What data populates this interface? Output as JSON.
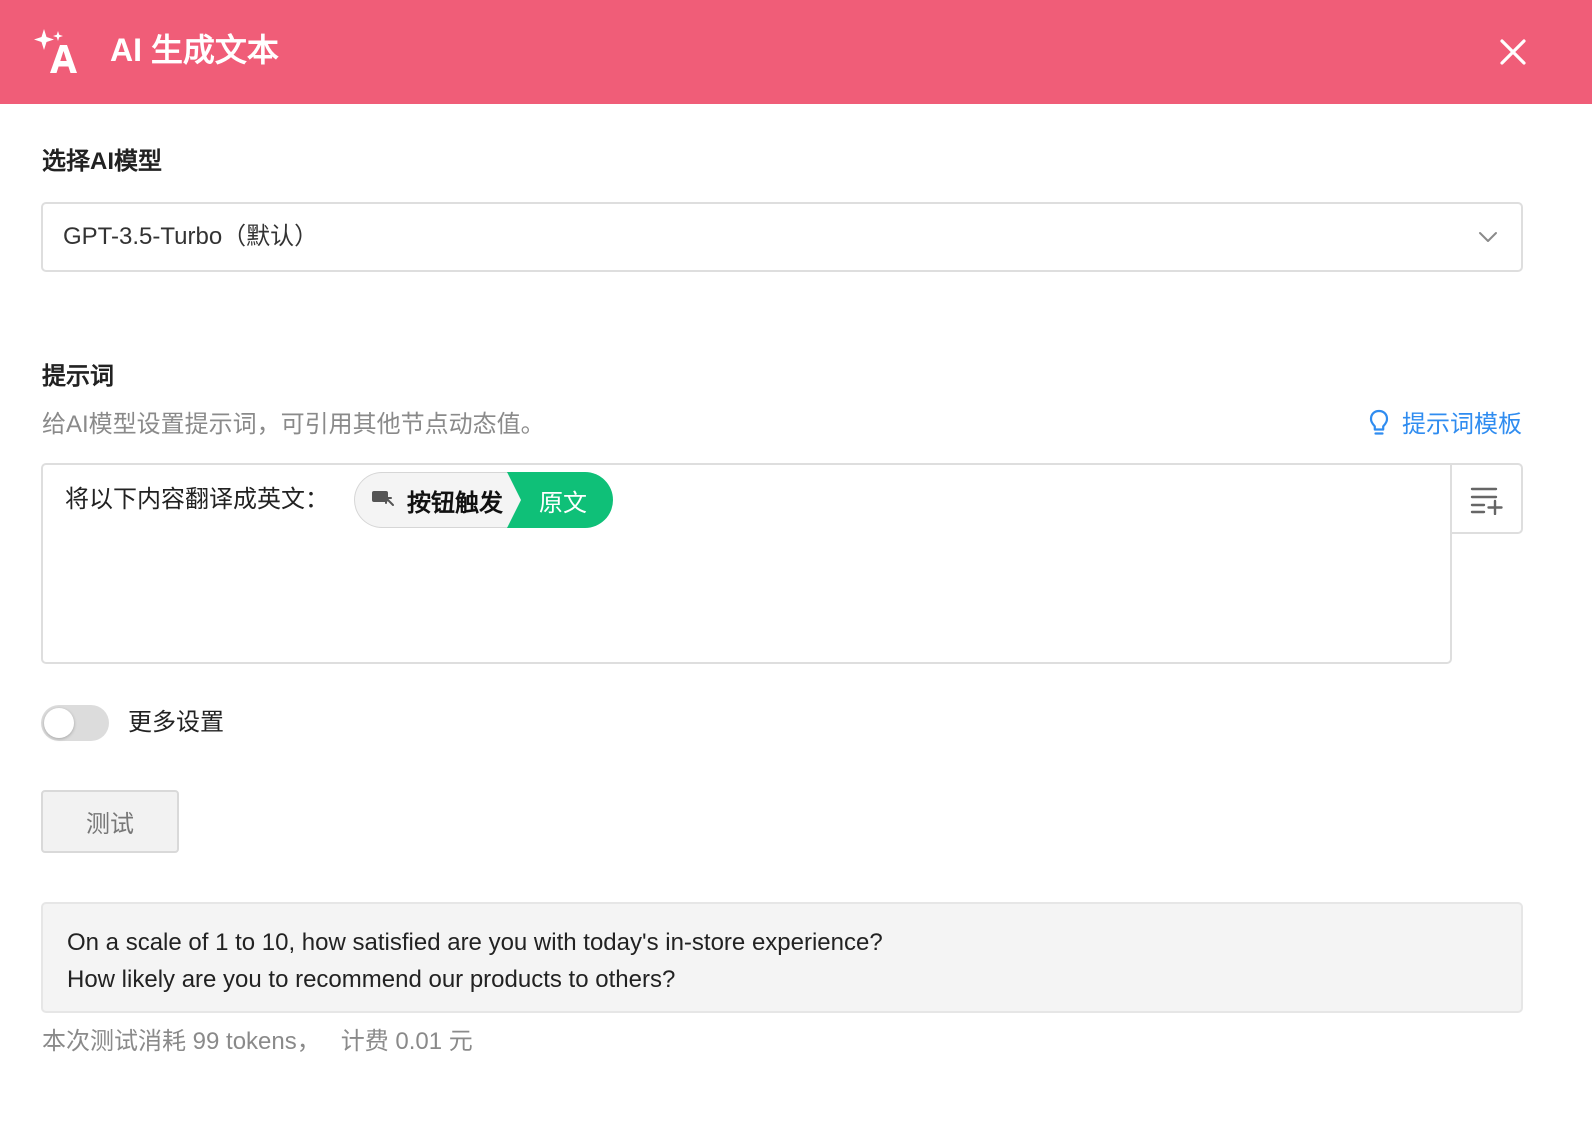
{
  "header": {
    "title": "AI 生成文本",
    "icon": "ai-sparkle-icon",
    "close_icon": "close-icon",
    "background_color": "#f05d78"
  },
  "model": {
    "label": "选择AI模型",
    "selected": "GPT-3.5-Turbo（默认）",
    "dropdown_icon": "chevron-down-icon"
  },
  "prompt": {
    "label": "提示词",
    "hint": "给AI模型设置提示词，可引用其他节点动态值。",
    "template_link": "提示词模板",
    "template_icon": "lightbulb-icon",
    "text": "将以下内容翻译成英文：",
    "variable": {
      "node": "按钮触发",
      "node_icon": "button-trigger-icon",
      "field": "原文",
      "field_color": "#0fc078"
    },
    "insert_icon": "insert-variable-icon"
  },
  "more_settings": {
    "label": "更多设置",
    "enabled": false
  },
  "test_button": "测试",
  "result": {
    "lines": [
      "On a scale of 1 to 10, how satisfied are you with today's in-store experience?",
      "How likely are you to recommend our products to others?"
    ]
  },
  "usage": {
    "tokens_text": "本次测试消耗 99 tokens，",
    "cost_text": "计费 0.01 元"
  },
  "accent_color": "#2f8cf0"
}
